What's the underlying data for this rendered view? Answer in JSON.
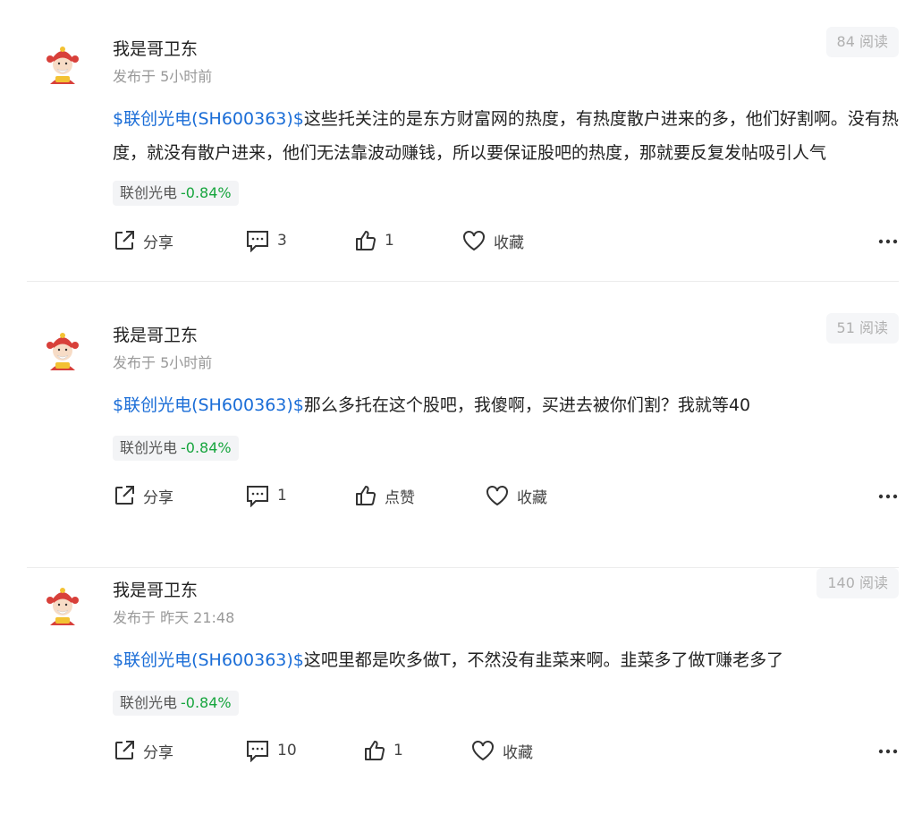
{
  "posts": [
    {
      "author": "我是哥卫东",
      "published": "发布于 5小时前",
      "reads": "84 阅读",
      "stock_link": "$联创光电(SH600363)$",
      "text": "这些托关注的是东方财富网的热度，有热度散户进来的多，他们好割啊。没有热度，就没有散户进来，他们无法靠波动赚钱，所以要保证股吧的热度，那就要反复发帖吸引人气",
      "tag_name": "联创光电",
      "tag_change": "-0.84%",
      "share_label": "分享",
      "comment_count": "3",
      "like_label": "1",
      "collect_label": "收藏"
    },
    {
      "author": "我是哥卫东",
      "published": "发布于 5小时前",
      "reads": "51 阅读",
      "stock_link": "$联创光电(SH600363)$",
      "text": "那么多托在这个股吧，我傻啊，买进去被你们割？我就等40",
      "tag_name": "联创光电",
      "tag_change": "-0.84%",
      "share_label": "分享",
      "comment_count": "1",
      "like_label": "点赞",
      "collect_label": "收藏"
    },
    {
      "author": "我是哥卫东",
      "published": "发布于 昨天 21:48",
      "reads": "140 阅读",
      "stock_link": "$联创光电(SH600363)$",
      "text": "这吧里都是吹多做T，不然没有韭菜来啊。韭菜多了做T赚老多了",
      "tag_name": "联创光电",
      "tag_change": "-0.84%",
      "share_label": "分享",
      "comment_count": "10",
      "like_label": "1",
      "collect_label": "收藏"
    }
  ],
  "colors": {
    "link": "#1a6dd7",
    "down": "#17a53e",
    "muted": "#999999"
  },
  "icons": [
    "share-icon",
    "comment-icon",
    "like-icon",
    "heart-icon",
    "more-icon"
  ]
}
